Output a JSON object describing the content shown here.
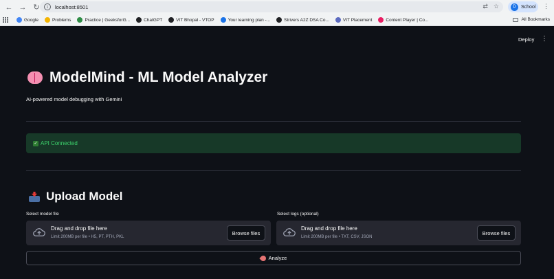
{
  "browser": {
    "url": "localhost:8501",
    "profile_initial": "D",
    "profile_name": "School",
    "bookmarks": [
      {
        "label": "Google",
        "color": "#4285f4"
      },
      {
        "label": "Problems",
        "color": "#f4b400"
      },
      {
        "label": "Practice | GeeksforG...",
        "color": "#2f8d46"
      },
      {
        "label": "ChatGPT",
        "color": "#202124"
      },
      {
        "label": "VIT Bhopal - VTOP",
        "color": "#202124"
      },
      {
        "label": "Your learning plan -...",
        "color": "#1a73e8"
      },
      {
        "label": "Strivers A2Z DSA Co...",
        "color": "#202124"
      },
      {
        "label": "VIT Placement",
        "color": "#5c6bc0"
      },
      {
        "label": "Content Player | Co...",
        "color": "#e91e63"
      }
    ],
    "all_bookmarks": "All Bookmarks"
  },
  "app": {
    "deploy_label": "Deploy",
    "title": "ModelMind - ML Model Analyzer",
    "subtitle": "AI-powered model debugging with Gemini",
    "status": {
      "text": "API Connected",
      "color": "#3dd56d"
    },
    "upload_heading": "Upload Model",
    "model_uploader": {
      "label": "Select model file",
      "drop_text": "Drag and drop file here",
      "limit_text": "Limit 200MB per file • H5, PT, PTH, PKL",
      "button": "Browse files"
    },
    "logs_uploader": {
      "label": "Select logs (optional)",
      "drop_text": "Drag and drop file here",
      "limit_text": "Limit 200MB per file • TXT, CSV, JSON",
      "button": "Browse files"
    },
    "analyze_button": "Analyze"
  }
}
